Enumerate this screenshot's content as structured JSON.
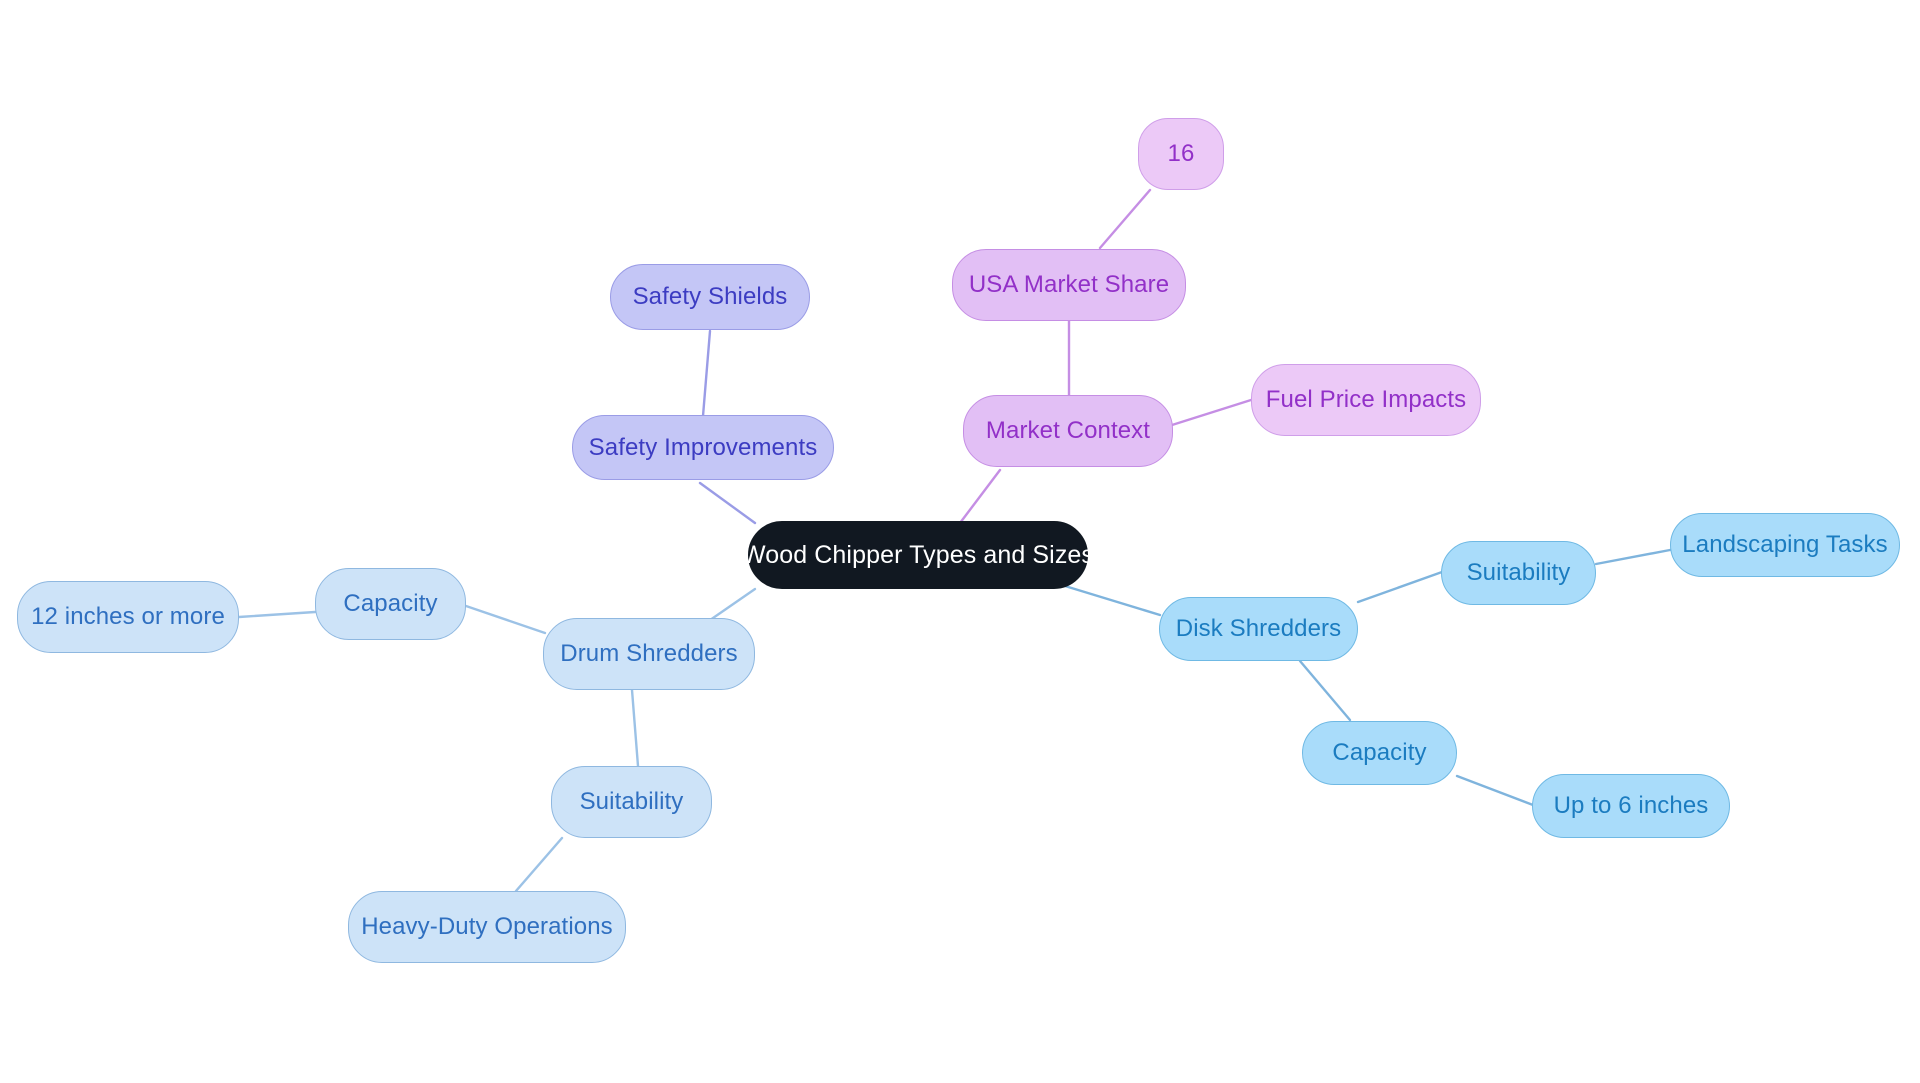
{
  "diagram": {
    "type": "mindmap",
    "title": "Wood Chipper Types and Sizes",
    "background": "#ffffff",
    "palette": {
      "root_fill": "#111821",
      "root_text": "#ffffff",
      "blue_mid_fill": "#a9dcfa",
      "blue_mid_text": "#1b7cc0",
      "blue_light_fill": "#cde3f8",
      "blue_light_text": "#2f6fc0",
      "lavender_fill": "#c4c6f6",
      "lavender_text": "#3c3cc2",
      "orchid_fill": "#e2bff5",
      "orchid_light_fill": "#ecc9f7",
      "orchid_text": "#9230c8",
      "edge_blue": "#7fb4dd",
      "edge_blue_light": "#9cc2e6",
      "edge_lavender": "#9a9ce6",
      "edge_orchid": "#c58ee4"
    }
  },
  "nodes": {
    "root": {
      "label": "Wood Chipper Types and Sizes"
    },
    "safety_improvements": {
      "label": "Safety Improvements"
    },
    "safety_shields": {
      "label": "Safety Shields"
    },
    "market_context": {
      "label": "Market Context"
    },
    "usa_market_share": {
      "label": "USA Market Share"
    },
    "usa_market_share_value": {
      "label": "16"
    },
    "fuel_price_impacts": {
      "label": "Fuel Price Impacts"
    },
    "drum_shredders": {
      "label": "Drum Shredders"
    },
    "drum_capacity": {
      "label": "Capacity"
    },
    "drum_capacity_value": {
      "label": "12 inches or more"
    },
    "drum_suitability": {
      "label": "Suitability"
    },
    "drum_suitability_value": {
      "label": "Heavy-Duty Operations"
    },
    "disk_shredders": {
      "label": "Disk Shredders"
    },
    "disk_suitability": {
      "label": "Suitability"
    },
    "disk_suitability_value": {
      "label": "Landscaping Tasks"
    },
    "disk_capacity": {
      "label": "Capacity"
    },
    "disk_capacity_value": {
      "label": "Up to 6 inches"
    }
  },
  "edges": [
    {
      "from": "root",
      "to": "safety_improvements"
    },
    {
      "from": "safety_improvements",
      "to": "safety_shields"
    },
    {
      "from": "root",
      "to": "market_context"
    },
    {
      "from": "market_context",
      "to": "usa_market_share"
    },
    {
      "from": "usa_market_share",
      "to": "usa_market_share_value"
    },
    {
      "from": "market_context",
      "to": "fuel_price_impacts"
    },
    {
      "from": "root",
      "to": "drum_shredders"
    },
    {
      "from": "drum_shredders",
      "to": "drum_capacity"
    },
    {
      "from": "drum_capacity",
      "to": "drum_capacity_value"
    },
    {
      "from": "drum_shredders",
      "to": "drum_suitability"
    },
    {
      "from": "drum_suitability",
      "to": "drum_suitability_value"
    },
    {
      "from": "root",
      "to": "disk_shredders"
    },
    {
      "from": "disk_shredders",
      "to": "disk_suitability"
    },
    {
      "from": "disk_suitability",
      "to": "disk_suitability_value"
    },
    {
      "from": "disk_shredders",
      "to": "disk_capacity"
    },
    {
      "from": "disk_capacity",
      "to": "disk_capacity_value"
    }
  ]
}
